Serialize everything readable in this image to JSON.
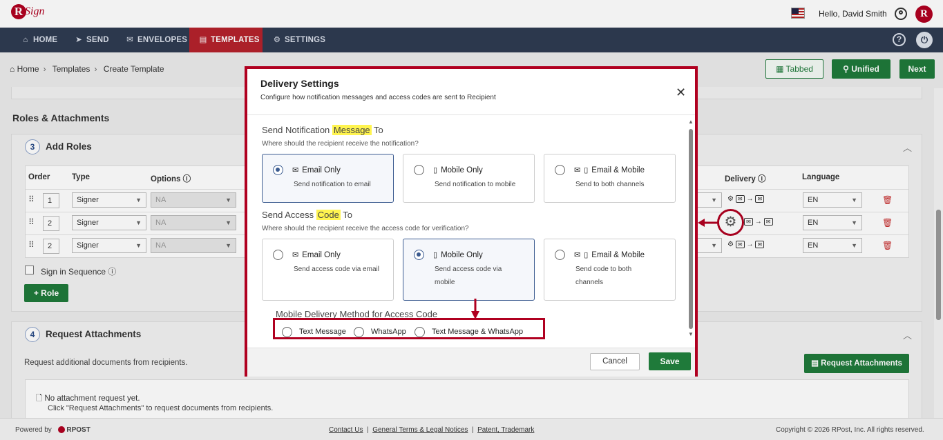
{
  "topbar": {
    "logo_initial": "R",
    "logo_text": "Sign",
    "greeting": "Hello, David Smith",
    "avatar_initial": "R"
  },
  "nav": {
    "items": [
      {
        "label": "HOME",
        "icon": "home-icon"
      },
      {
        "label": "SEND",
        "icon": "send-icon"
      },
      {
        "label": "ENVELOPES",
        "icon": "envelope-icon"
      },
      {
        "label": "TEMPLATES",
        "icon": "template-icon",
        "active": true
      },
      {
        "label": "SETTINGS",
        "icon": "gear-icon"
      }
    ]
  },
  "breadcrumb": {
    "home": "Home",
    "templates": "Templates",
    "current": "Create Template"
  },
  "actions": {
    "tabbed": "Tabbed",
    "unified": "Unified",
    "next": "Next"
  },
  "roles_section": {
    "title": "Roles & Attachments",
    "add_roles": {
      "number": "3",
      "title": "Add Roles"
    },
    "columns": {
      "order": "Order",
      "type": "Type",
      "options": "Options",
      "delivery": "Delivery",
      "language": "Language"
    },
    "rows": [
      {
        "order": "1",
        "type": "Signer",
        "options": "NA",
        "language": "EN"
      },
      {
        "order": "2",
        "type": "Signer",
        "options": "NA",
        "language": "EN"
      },
      {
        "order": "2",
        "type": "Signer",
        "options": "NA",
        "language": "EN"
      }
    ],
    "sign_in_sequence": "Sign in Sequence",
    "role_button": "Role"
  },
  "attachments_section": {
    "number": "4",
    "title": "Request Attachments",
    "description": "Request additional documents from recipients.",
    "button": "Request Attachments",
    "empty_title": "No attachment request yet.",
    "empty_hint": "Click \"Request Attachments\" to request documents from recipients."
  },
  "footer": {
    "powered_by": "Powered by",
    "brand": "RPOST",
    "contact": "Contact Us",
    "terms": "General Terms & Legal Notices",
    "patent": "Patent, Trademark",
    "copyright": "Copyright © 2026 RPost, Inc. All rights reserved."
  },
  "modal": {
    "title": "Delivery Settings",
    "subtitle": "Configure how notification messages and access codes are sent to Recipient",
    "notification": {
      "title_pre": "Send Notification ",
      "title_hl": "Message",
      "title_post": " To",
      "help": "Where should the recipient receive the notification?",
      "options": [
        {
          "title": "Email Only",
          "desc": "Send notification to email",
          "selected": true
        },
        {
          "title": "Mobile Only",
          "desc": "Send notification to mobile",
          "selected": false
        },
        {
          "title": "Email & Mobile",
          "desc": "Send to both channels",
          "selected": false
        }
      ]
    },
    "access_code": {
      "title_pre": "Send Access ",
      "title_hl": "Code",
      "title_post": " To",
      "help": "Where should the recipient receive the access code for verification?",
      "options": [
        {
          "title": "Email Only",
          "desc1": "Send access code via email",
          "desc2": "",
          "selected": false
        },
        {
          "title": "Mobile Only",
          "desc1": "Send access code via",
          "desc2": "mobile",
          "selected": true
        },
        {
          "title": "Email & Mobile",
          "desc1": "Send code to both",
          "desc2": "channels",
          "selected": false
        }
      ]
    },
    "mobile_method": {
      "title": "Mobile Delivery Method for Access Code",
      "options": [
        "Text Message",
        "WhatsApp",
        "Text Message & WhatsApp"
      ]
    },
    "cancel": "Cancel",
    "save": "Save"
  },
  "colors": {
    "brand_red": "#b00020",
    "nav_bg": "#2f3b52",
    "active_tab": "#b5222c",
    "primary_green": "#1f7a3a",
    "highlight": "#fff44f"
  }
}
